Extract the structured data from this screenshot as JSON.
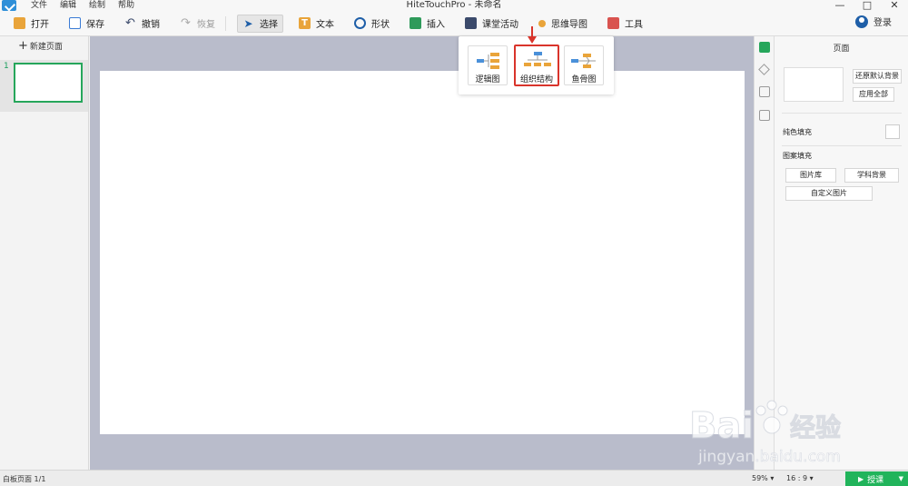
{
  "app": {
    "title": "HiteTouchPro - 未命名",
    "menu": [
      "文件",
      "编辑",
      "绘制",
      "帮助"
    ],
    "window_controls": [
      "—",
      "□",
      "✕"
    ]
  },
  "toolbar": {
    "open": "打开",
    "save": "保存",
    "undo": "撤销",
    "redo": "恢复",
    "select": "选择",
    "text": "文本",
    "shape": "形状",
    "insert": "插入",
    "classroom": "课堂活动",
    "mindmap": "思维导图",
    "tools": "工具",
    "login": "登录"
  },
  "left_panel": {
    "new_page": "新建页面",
    "pages": [
      {
        "number": "1"
      }
    ]
  },
  "mindmap_popup": {
    "options": [
      {
        "label": "逻辑图",
        "icon": "logic-chart-icon"
      },
      {
        "label": "组织结构",
        "icon": "org-chart-icon",
        "highlighted": true
      },
      {
        "label": "鱼骨图",
        "icon": "fishbone-icon"
      }
    ]
  },
  "right_panel": {
    "title": "页面",
    "restore_default_bg": "还原默认背景",
    "apply_all": "应用全部",
    "solid_fill": "纯色填充",
    "pattern_fill": "图案填充",
    "gallery": "图片库",
    "subject_bg": "学科背景",
    "custom_image": "自定义图片"
  },
  "status": {
    "page_info": "白板页面 1/1",
    "zoom": "59%",
    "ratio": "16 : 9",
    "present": "授课"
  },
  "watermark": {
    "brand": "Bai",
    "brand_tail": "经验",
    "url": "jingyan.baidu.com"
  },
  "colors": {
    "accent_green": "#21b45b",
    "highlight_red": "#d9342b",
    "canvas_bg": "#b9bccb"
  }
}
